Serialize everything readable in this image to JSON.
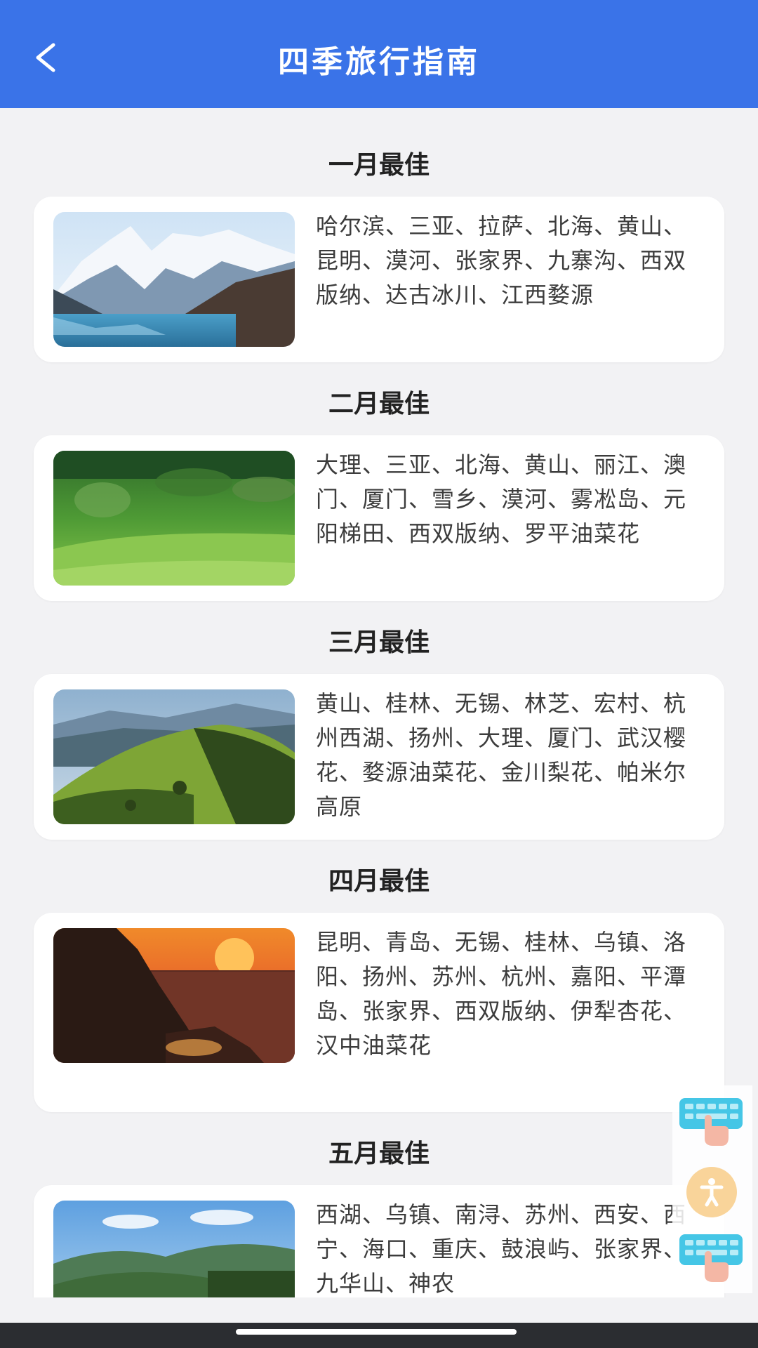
{
  "header": {
    "title": "四季旅行指南",
    "back_icon": "chevron-left-icon"
  },
  "colors": {
    "header_bg": "#3a73e8",
    "page_bg": "#f2f2f4",
    "card_bg": "#ffffff"
  },
  "sections": [
    {
      "title": "一月最佳",
      "image": "snow-mountain-lake",
      "text": "哈尔滨、三亚、拉萨、北海、黄山、昆明、漠河、张家界、九寨沟、西双版纳、达古冰川、江西婺源"
    },
    {
      "title": "二月最佳",
      "image": "green-meadow",
      "text": "大理、三亚、北海、黄山、丽江、澳门、厦门、雪乡、漠河、雾凇岛、元阳梯田、西双版纳、罗平油菜花"
    },
    {
      "title": "三月最佳",
      "image": "green-hills",
      "text": "黄山、桂林、无锡、林芝、宏村、杭州西湖、扬州、大理、厦门、武汉樱花、婺源油菜花、金川梨花、帕米尔高原"
    },
    {
      "title": "四月最佳",
      "image": "sunset-cliff-sea",
      "text": "昆明、青岛、无锡、桂林、乌镇、洛阳、扬州、苏州、杭州、嘉阳、平潭岛、张家界、西双版纳、伊犁杏花、汉中油菜花"
    },
    {
      "title": "五月最佳",
      "image": "mountain-sky",
      "text": "西湖、乌镇、南浔、苏州、西安、西宁、海口、重庆、鼓浪屿、张家界、九华山、神农"
    }
  ],
  "floating": {
    "tool1": "keyboard-touch-icon",
    "tool2": "accessibility-icon",
    "tool3": "keyboard-touch-icon"
  }
}
